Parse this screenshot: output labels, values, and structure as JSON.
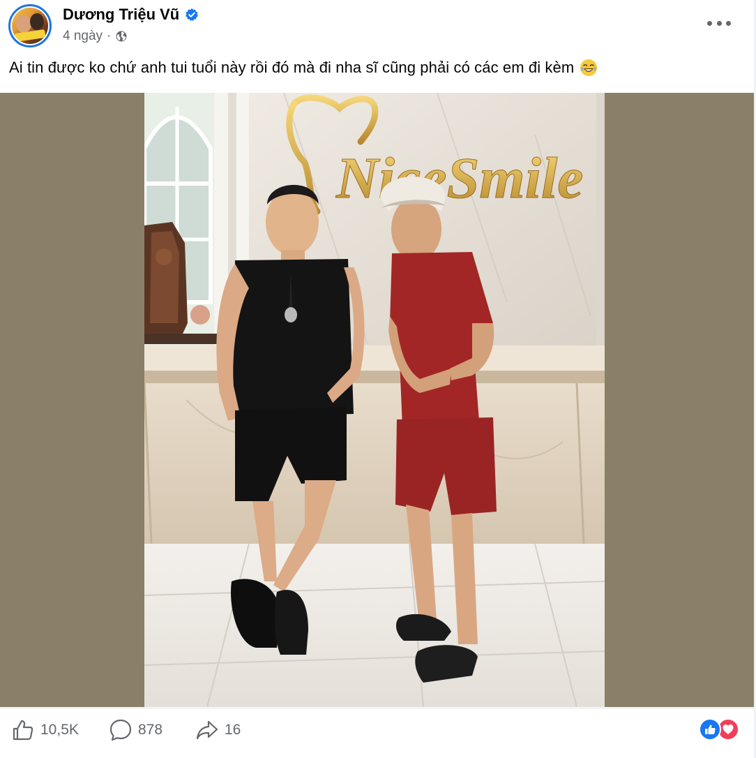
{
  "post": {
    "author": "Dương Triệu Vũ",
    "time": "4 ngày",
    "separator": "·",
    "caption": "Ai tin được ko chứ anh tui tuổi này rồi đó mà đi nha sĩ cũng phải có các em đi kèm",
    "caption_emoji": "laughing-crying-emoji",
    "photo_sign_text": "NiceSmile"
  },
  "stats": {
    "likes": "10,5K",
    "comments": "878",
    "shares": "16"
  },
  "icons": {
    "verified": "verified-badge-icon",
    "audience": "globe-icon",
    "more": "more-options-icon",
    "like": "thumbs-up-icon",
    "comment": "comment-bubble-icon",
    "share": "share-arrow-icon",
    "reaction_like": "like-reaction-icon",
    "reaction_love": "love-reaction-icon"
  },
  "colors": {
    "accent": "#1877f2",
    "love": "#f33e58",
    "text_secondary": "#65676b",
    "media_background": "#8a7f67"
  }
}
